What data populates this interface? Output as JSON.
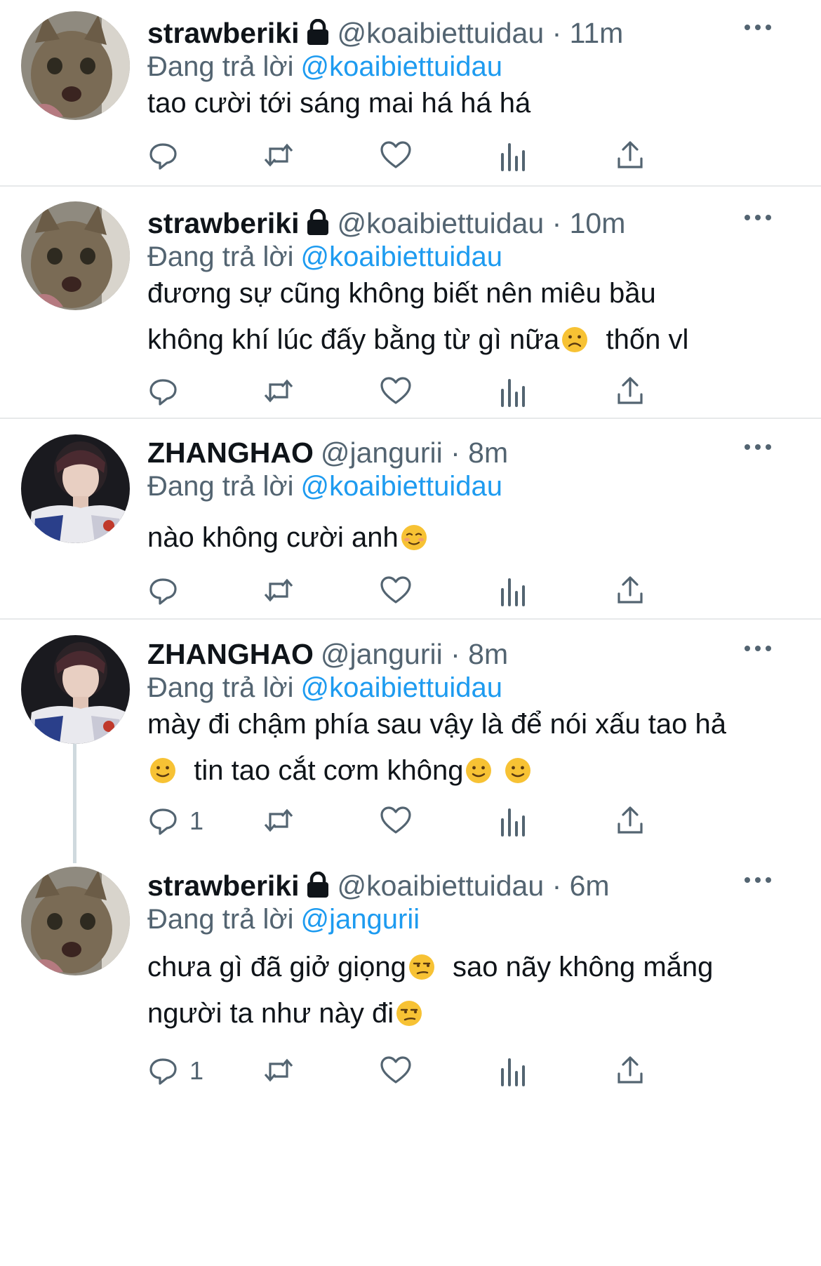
{
  "reply_prefix": "Đang trả lời",
  "tweets": [
    {
      "name": "strawberiki",
      "locked": true,
      "handle": "@koaibiettuidau",
      "sep": "·",
      "time": "11m",
      "reply_to": "@koaibiettuidau",
      "lines": [
        "tao cười tới sáng mai há há há"
      ],
      "reply_count": ""
    },
    {
      "name": "strawberiki",
      "locked": true,
      "handle": "@koaibiettuidau",
      "sep": "·",
      "time": "10m",
      "reply_to": "@koaibiettuidau",
      "lines": [
        "đương sự cũng không biết nên miêu bầu",
        "không khí lúc đấy bằng từ gì nữa",
        "thốn vl"
      ],
      "reply_count": ""
    },
    {
      "name": "ZHANGHAO",
      "locked": false,
      "handle": "@jangurii",
      "sep": "·",
      "time": "8m",
      "reply_to": "@koaibiettuidau",
      "lines": [
        "nào không cười anh"
      ],
      "reply_count": ""
    },
    {
      "name": "ZHANGHAO",
      "locked": false,
      "handle": "@jangurii",
      "sep": "·",
      "time": "8m",
      "reply_to": "@koaibiettuidau",
      "lines": [
        "mày đi chậm phía sau vậy là để nói xấu tao hả",
        "tin tao cắt cơm không"
      ],
      "reply_count": "1"
    },
    {
      "name": "strawberiki",
      "locked": true,
      "handle": "@koaibiettuidau",
      "sep": "·",
      "time": "6m",
      "reply_to": "@jangurii",
      "lines": [
        "chưa gì đã giở giọng",
        "sao nãy không mắng",
        "người ta như này đi"
      ],
      "reply_count": "1"
    }
  ],
  "colors": {
    "text": "#0f1419",
    "secondary": "#536471",
    "link": "#1d9bf0",
    "divider": "#e7e9ea",
    "thread_line": "#cfd9de",
    "emoji": "#f7c234"
  },
  "icons": {
    "reply": "reply-icon",
    "retweet": "retweet-icon",
    "like": "like-icon",
    "views": "views-icon",
    "share": "share-icon",
    "more": "more-icon",
    "lock": "lock-icon"
  }
}
